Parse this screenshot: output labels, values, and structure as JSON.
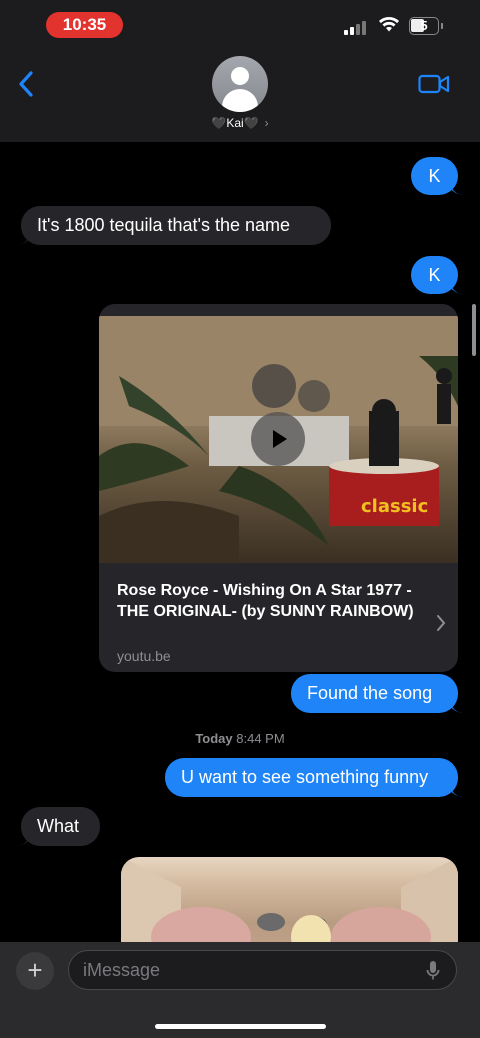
{
  "status_bar": {
    "time": "10:35",
    "battery": "5"
  },
  "header": {
    "contact_name": "🖤Kai🖤",
    "name_chevron": "›"
  },
  "messages": {
    "m1": "K",
    "m2": "It's 1800 tequila that's the name",
    "m3": "K",
    "m4": "Found the song",
    "m5": "U want to see something funny",
    "m6": "What"
  },
  "link_preview": {
    "title": "Rose Royce - Wishing On A Star 1977 -THE ORIGINAL- (by SUNNY RAINBOW)",
    "domain": "youtu.be",
    "thumbnail_badge": "classic"
  },
  "timestamp": {
    "day": "Today",
    "time": "8:44 PM"
  },
  "input": {
    "placeholder": "iMessage",
    "plus": "+"
  },
  "icons": {
    "back": "chevron-left-icon",
    "video": "video-camera-icon",
    "play": "play-icon",
    "mic": "microphone-icon",
    "plus": "plus-icon"
  },
  "colors": {
    "outgoing_bubble": "#1f84f7",
    "incoming_bubble": "#26252a",
    "accent": "#1f84f7",
    "time_pill": "#e3332e"
  }
}
